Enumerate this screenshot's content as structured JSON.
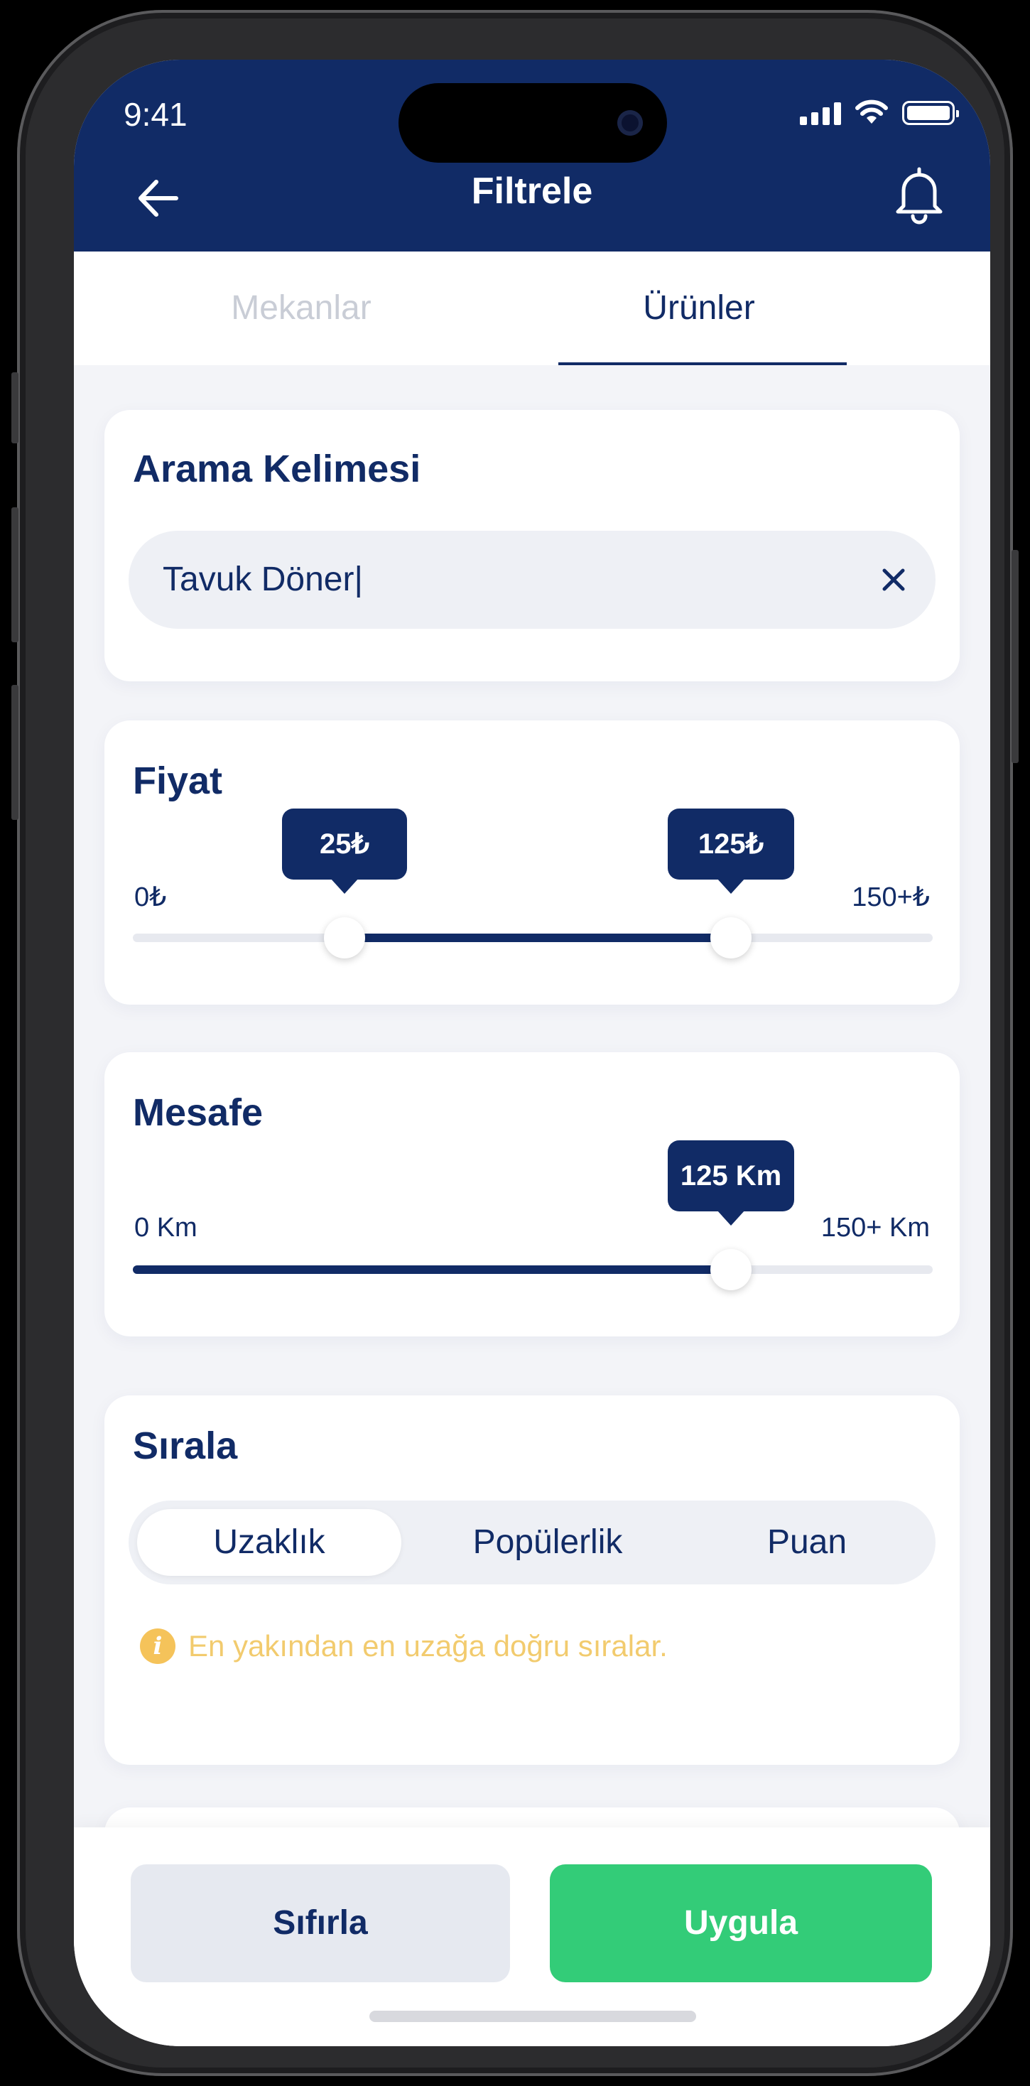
{
  "status_bar": {
    "time": "9:41"
  },
  "header": {
    "title": "Filtrele"
  },
  "tabs": [
    {
      "label": "Mekanlar",
      "active": false
    },
    {
      "label": "Ürünler",
      "active": true
    }
  ],
  "search": {
    "title": "Arama Kelimesi",
    "value": "Tavuk Döner|"
  },
  "price": {
    "title": "Fiyat",
    "min_label": "0₺",
    "max_label": "150+₺",
    "low_label": "25₺",
    "high_label": "125₺",
    "min": 0,
    "max": 150,
    "low": 25,
    "high": 125
  },
  "distance": {
    "title": "Mesafe",
    "min_label": "0 Km",
    "max_label": "150+ Km",
    "value_label": "125 Km",
    "min": 0,
    "max": 150,
    "value": 125
  },
  "sort": {
    "title": "Sırala",
    "options": [
      "Uzaklık",
      "Popülerlik",
      "Puan"
    ],
    "selected": "Uzaklık",
    "info": "En yakından en uzağa doğru sıralar."
  },
  "actions": {
    "reset": "Sıfırla",
    "apply": "Uygula"
  },
  "colors": {
    "primary": "#112b66",
    "accent": "#33cc78",
    "info": "#f5c35a"
  }
}
